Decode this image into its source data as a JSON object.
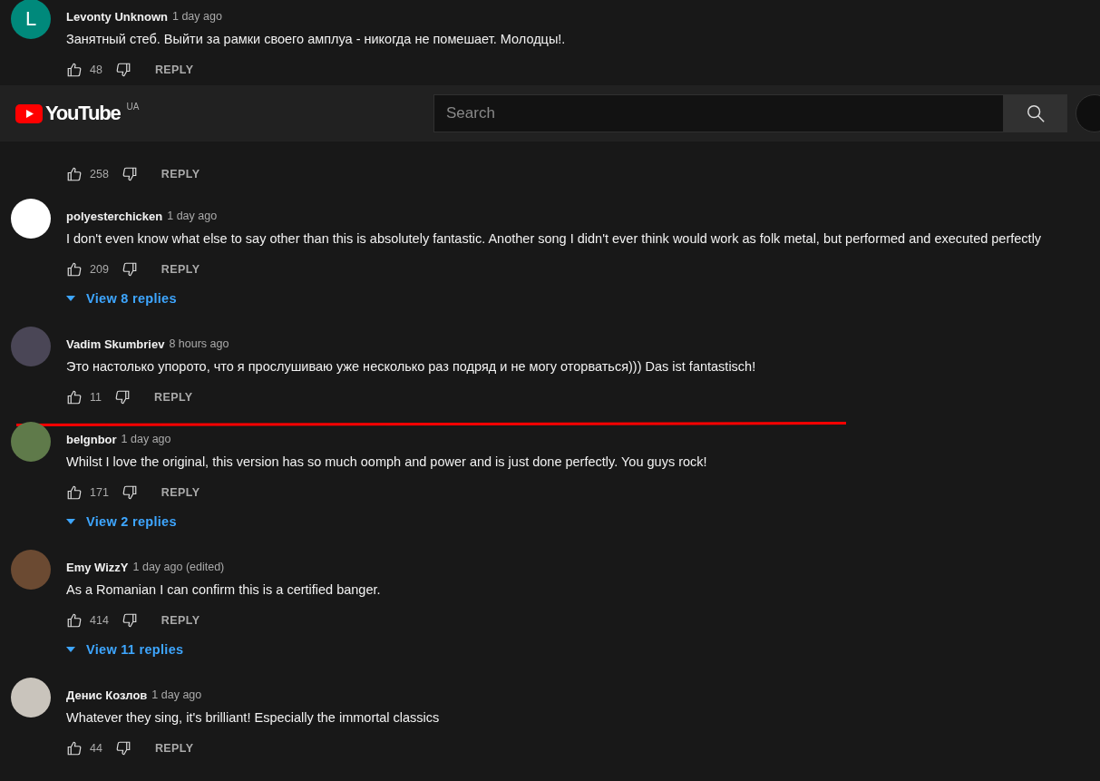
{
  "header": {
    "logo": "YouTube",
    "country": "UA",
    "search": {
      "placeholder": "Search"
    }
  },
  "comments": [
    {
      "author": "Levonty Unknown",
      "time": "1 day ago",
      "avatar_letter": "L",
      "color": "#00897b",
      "text": "Занятный  стеб. Выйти за рамки своего амплуа - никогда не помешает. Молодцы!.",
      "likes": "48",
      "reply": "REPLY",
      "underlined": false
    },
    {
      "likes": "258",
      "reply": "REPLY",
      "underlined": false
    },
    {
      "author": "polyesterchicken",
      "time": "1 day ago",
      "color": "#ffffff",
      "text": "I don't even know what else to say other than this is absolutely fantastic. Another song I didn't ever think would work as folk metal, but performed and executed perfectly",
      "likes": "209",
      "reply": "REPLY",
      "replies": "View 8 replies",
      "underlined": false
    },
    {
      "author": "Vadim Skumbriev",
      "time": "8 hours ago",
      "color": "#4a4656",
      "text": "Это настолько упорото, что я прослушиваю уже несколько раз подряд и не могу оторваться))) Das ist fantastisch!",
      "likes": "11",
      "reply": "REPLY",
      "underlined": true
    },
    {
      "author": "belgnbor",
      "time": "1 day ago",
      "color": "#5f7a4a",
      "text": "Whilst I love the original, this version has so much oomph and power and is just done perfectly.  You guys rock!",
      "likes": "171",
      "reply": "REPLY",
      "replies": "View 2 replies",
      "underlined": false
    },
    {
      "author": "Emy WizzY",
      "time": "1 day ago (edited)",
      "color": "#6b4a32",
      "text": "As a Romanian I can confirm this is a certified banger.",
      "likes": "414",
      "reply": "REPLY",
      "replies": "View 11 replies",
      "underlined": false
    },
    {
      "author": "Денис Козлов",
      "time": "1 day ago",
      "color": "#c9c4bc",
      "text": "Whatever they sing, it's brilliant! Especially the immortal classics",
      "likes": "44",
      "reply": "REPLY",
      "underlined": false
    }
  ]
}
